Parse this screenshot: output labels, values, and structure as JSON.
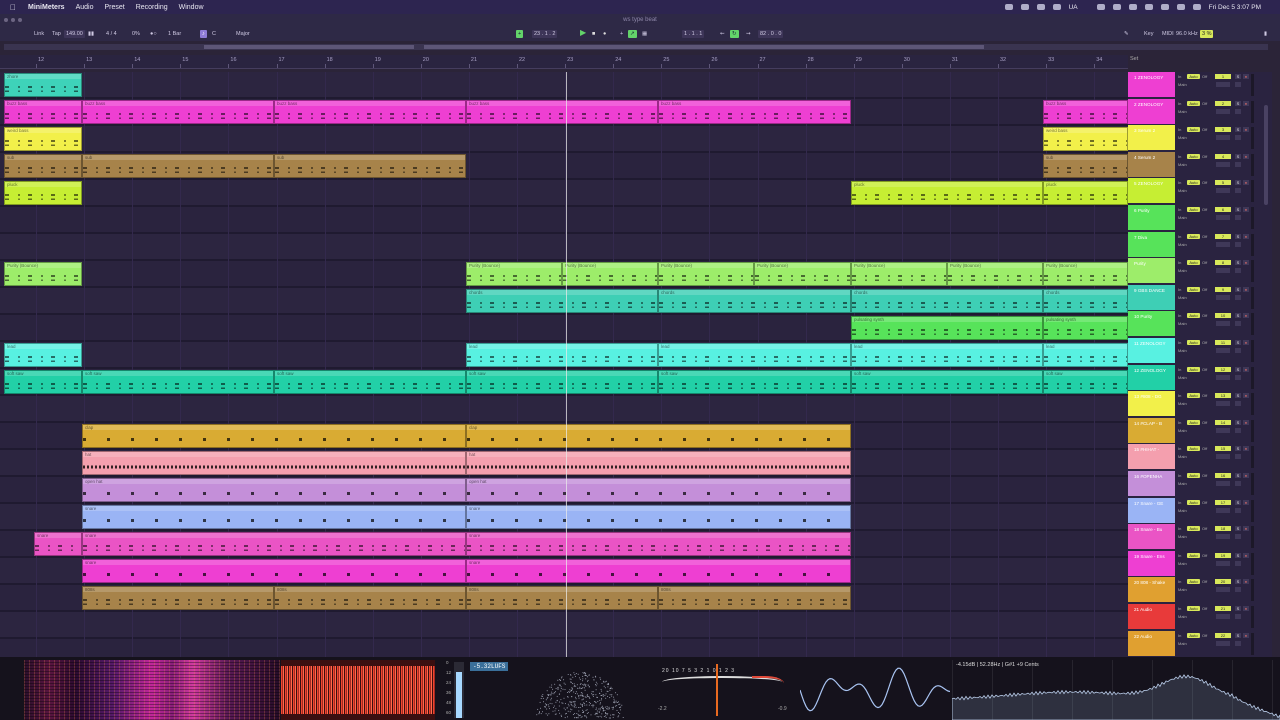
{
  "menubar": {
    "app": "MiniMeters",
    "items": [
      "Audio",
      "Preset",
      "Recording",
      "Window"
    ],
    "clock": "Fri Dec 5  3:07 PM",
    "ua": "UA"
  },
  "titlebar": {
    "title": "ws type beat"
  },
  "transport": {
    "link": "Link",
    "tap": "Tap",
    "tempo": "149.00",
    "signature": "4 / 4",
    "groove": "0%",
    "quant": "1 Bar",
    "key": "C",
    "scale": "Major",
    "position": "23 . 1 . 2",
    "loop_start": "1 . 1 . 1",
    "loop_length": "82 . 0 . 0",
    "key_label": "Key",
    "midi_label": "MIDI",
    "cpu_label": "96.0 kHz",
    "cpu_pct": "3 %"
  },
  "ruler": {
    "bars": [
      "12",
      "13",
      "14",
      "15",
      "16",
      "17",
      "18",
      "19",
      "20",
      "21",
      "22",
      "23",
      "24",
      "25",
      "26",
      "27",
      "28",
      "29",
      "30",
      "31",
      "32",
      "33",
      "34"
    ],
    "set_label": "Set"
  },
  "clips": [
    {
      "lane": 0,
      "start": 4,
      "end": 82,
      "color": "#3ed3b9",
      "name": "zhore"
    },
    {
      "lane": 1,
      "start": 4,
      "end": 82,
      "color": "#ee3fd2",
      "name": "buzz bass"
    },
    {
      "lane": 1,
      "start": 82,
      "end": 274,
      "color": "#ee3fd2",
      "name": "buzz bass"
    },
    {
      "lane": 1,
      "start": 274,
      "end": 466,
      "color": "#ee3fd2",
      "name": "buzz bass"
    },
    {
      "lane": 1,
      "start": 466,
      "end": 658,
      "color": "#ee3fd2",
      "name": "buzz bass"
    },
    {
      "lane": 1,
      "start": 658,
      "end": 851,
      "color": "#ee3fd2",
      "name": "buzz bass"
    },
    {
      "lane": 1,
      "start": 1043,
      "end": 1128,
      "color": "#ee3fd2",
      "name": "buzz bass"
    },
    {
      "lane": 2,
      "start": 4,
      "end": 82,
      "color": "#f2f04a",
      "name": "weird bass"
    },
    {
      "lane": 2,
      "start": 1043,
      "end": 1128,
      "color": "#f2f04a",
      "name": "weird bass"
    },
    {
      "lane": 3,
      "start": 4,
      "end": 82,
      "color": "#a7834a",
      "name": "sub"
    },
    {
      "lane": 3,
      "start": 82,
      "end": 274,
      "color": "#a7834a",
      "name": "sub"
    },
    {
      "lane": 3,
      "start": 274,
      "end": 466,
      "color": "#a7834a",
      "name": "sub"
    },
    {
      "lane": 3,
      "start": 1043,
      "end": 1128,
      "color": "#a7834a",
      "name": "sub"
    },
    {
      "lane": 4,
      "start": 4,
      "end": 82,
      "color": "#c6ee33",
      "name": "pluck"
    },
    {
      "lane": 4,
      "start": 851,
      "end": 1043,
      "color": "#c6ee33",
      "name": "pluck"
    },
    {
      "lane": 4,
      "start": 1043,
      "end": 1128,
      "color": "#c6ee33",
      "name": "pluck"
    },
    {
      "lane": 7,
      "start": 4,
      "end": 82,
      "color": "#9ded6a",
      "name": "Purity (Bounce)"
    },
    {
      "lane": 7,
      "start": 466,
      "end": 562,
      "color": "#9ded6a",
      "name": "Purity (Bounce)"
    },
    {
      "lane": 7,
      "start": 562,
      "end": 658,
      "color": "#9ded6a",
      "name": "Purity (Bounce)"
    },
    {
      "lane": 7,
      "start": 658,
      "end": 754,
      "color": "#9ded6a",
      "name": "Purity (Bounce)"
    },
    {
      "lane": 7,
      "start": 754,
      "end": 851,
      "color": "#9ded6a",
      "name": "Purity (Bounce)"
    },
    {
      "lane": 7,
      "start": 851,
      "end": 947,
      "color": "#9ded6a",
      "name": "Purity (Bounce)"
    },
    {
      "lane": 7,
      "start": 947,
      "end": 1043,
      "color": "#9ded6a",
      "name": "Purity (Bounce)"
    },
    {
      "lane": 7,
      "start": 1043,
      "end": 1128,
      "color": "#9ded6a",
      "name": "Purity (Bounce)"
    },
    {
      "lane": 8,
      "start": 466,
      "end": 658,
      "color": "#3ecfb5",
      "name": "chords"
    },
    {
      "lane": 8,
      "start": 658,
      "end": 851,
      "color": "#3ecfb5",
      "name": "chords"
    },
    {
      "lane": 8,
      "start": 851,
      "end": 1043,
      "color": "#3ecfb5",
      "name": "chords"
    },
    {
      "lane": 8,
      "start": 1043,
      "end": 1128,
      "color": "#3ecfb5",
      "name": "chords"
    },
    {
      "lane": 9,
      "start": 851,
      "end": 1043,
      "color": "#57e35a",
      "name": "pulsating synth"
    },
    {
      "lane": 9,
      "start": 1043,
      "end": 1128,
      "color": "#57e35a",
      "name": "pulsating synth"
    },
    {
      "lane": 10,
      "start": 4,
      "end": 82,
      "color": "#58f1e1",
      "name": "lead"
    },
    {
      "lane": 10,
      "start": 466,
      "end": 658,
      "color": "#58f1e1",
      "name": "lead"
    },
    {
      "lane": 10,
      "start": 658,
      "end": 851,
      "color": "#58f1e1",
      "name": "lead"
    },
    {
      "lane": 10,
      "start": 851,
      "end": 1043,
      "color": "#58f1e1",
      "name": "lead"
    },
    {
      "lane": 10,
      "start": 1043,
      "end": 1128,
      "color": "#58f1e1",
      "name": "lead"
    },
    {
      "lane": 11,
      "start": 4,
      "end": 82,
      "color": "#22d0a7",
      "name": "soft saw"
    },
    {
      "lane": 11,
      "start": 82,
      "end": 274,
      "color": "#22d0a7",
      "name": "soft saw"
    },
    {
      "lane": 11,
      "start": 274,
      "end": 466,
      "color": "#22d0a7",
      "name": "soft saw"
    },
    {
      "lane": 11,
      "start": 466,
      "end": 658,
      "color": "#22d0a7",
      "name": "soft saw"
    },
    {
      "lane": 11,
      "start": 658,
      "end": 851,
      "color": "#22d0a7",
      "name": "soft saw"
    },
    {
      "lane": 11,
      "start": 851,
      "end": 1043,
      "color": "#22d0a7",
      "name": "soft saw"
    },
    {
      "lane": 11,
      "start": 1043,
      "end": 1128,
      "color": "#22d0a7",
      "name": "soft saw"
    },
    {
      "lane": 13,
      "start": 82,
      "end": 466,
      "color": "#d9ab33",
      "name": "clap",
      "kind": "dots"
    },
    {
      "lane": 13,
      "start": 466,
      "end": 851,
      "color": "#d9ab33",
      "name": "clap",
      "kind": "dots"
    },
    {
      "lane": 14,
      "start": 82,
      "end": 466,
      "color": "#f49fae",
      "name": "hat",
      "kind": "dense"
    },
    {
      "lane": 14,
      "start": 466,
      "end": 851,
      "color": "#f49fae",
      "name": "hat",
      "kind": "dense"
    },
    {
      "lane": 15,
      "start": 82,
      "end": 466,
      "color": "#c48fd9",
      "name": "open hat",
      "kind": "dots"
    },
    {
      "lane": 15,
      "start": 466,
      "end": 851,
      "color": "#c48fd9",
      "name": "open hat",
      "kind": "dots"
    },
    {
      "lane": 16,
      "start": 82,
      "end": 466,
      "color": "#9ab4f5",
      "name": "snare",
      "kind": "dots"
    },
    {
      "lane": 16,
      "start": 466,
      "end": 851,
      "color": "#9ab4f5",
      "name": "snare",
      "kind": "dots"
    },
    {
      "lane": 17,
      "start": 34,
      "end": 82,
      "color": "#ea54c5",
      "name": "snare"
    },
    {
      "lane": 17,
      "start": 82,
      "end": 466,
      "color": "#ea54c5",
      "name": "snare"
    },
    {
      "lane": 17,
      "start": 466,
      "end": 851,
      "color": "#ea54c5",
      "name": "snare"
    },
    {
      "lane": 18,
      "start": 82,
      "end": 466,
      "color": "#ee3fd2",
      "name": "snare",
      "kind": "dots"
    },
    {
      "lane": 18,
      "start": 466,
      "end": 851,
      "color": "#ee3fd2",
      "name": "snare",
      "kind": "dots"
    },
    {
      "lane": 19,
      "start": 82,
      "end": 274,
      "color": "#a7834a",
      "name": "808s"
    },
    {
      "lane": 19,
      "start": 274,
      "end": 466,
      "color": "#a7834a",
      "name": "808s"
    },
    {
      "lane": 19,
      "start": 466,
      "end": 658,
      "color": "#a7834a",
      "name": "808s"
    },
    {
      "lane": 19,
      "start": 658,
      "end": 851,
      "color": "#a7834a",
      "name": "808s"
    }
  ],
  "tracks": [
    {
      "name": "1 ZENOLOGY",
      "color": "#ee3fd2",
      "num": "1"
    },
    {
      "name": "2 ZENOLOGY",
      "color": "#ee3fd2",
      "num": "2"
    },
    {
      "name": "3 Serum 2",
      "color": "#f2f04a",
      "num": "3"
    },
    {
      "name": "4 Serum 2",
      "color": "#a7834a",
      "num": "4"
    },
    {
      "name": "5 ZENOLOGY",
      "color": "#c6ee33",
      "num": "5"
    },
    {
      "name": "6 Purity",
      "color": "#57e35a",
      "num": "6"
    },
    {
      "name": "7 Diva",
      "color": "#57e35a",
      "num": "7"
    },
    {
      "name": "Purity",
      "color": "#9ded6a",
      "num": "8"
    },
    {
      "name": "9 GBS DANCE",
      "color": "#3ecfb5",
      "num": "9"
    },
    {
      "name": "10 Purity",
      "color": "#57e35a",
      "num": "10"
    },
    {
      "name": "11 ZENOLOGY",
      "color": "#58f1e1",
      "num": "11"
    },
    {
      "name": "12 ZENOLOGY",
      "color": "#22d0a7",
      "num": "12"
    },
    {
      "name": "13 #808 - DG",
      "color": "#f2f04a",
      "num": "13"
    },
    {
      "name": "14 #CLAP - B",
      "color": "#d9ab33",
      "num": "14"
    },
    {
      "name": "15 #HIHAT -",
      "color": "#f49fae",
      "num": "15"
    },
    {
      "name": "16 #OPENHA",
      "color": "#c48fd9",
      "num": "16"
    },
    {
      "name": "17 Snare - GE",
      "color": "#9ab4f5",
      "num": "17"
    },
    {
      "name": "18 Snare - Bu",
      "color": "#ea54c5",
      "num": "18"
    },
    {
      "name": "19 Snare - Ens",
      "color": "#ee3fd2",
      "num": "19"
    },
    {
      "name": "20 808 - Shake",
      "color": "#e0a030",
      "num": "20"
    },
    {
      "name": "21 Audio",
      "color": "#e83a3a",
      "num": "21"
    },
    {
      "name": "22 Audio",
      "color": "#e0a030",
      "num": "22"
    }
  ],
  "track_labels": {
    "in": "In",
    "auto": "Auto",
    "off": "Off",
    "main": "Main",
    "solo": "S",
    "rec": "●"
  },
  "meters": {
    "lufs_value": "-5.32LUFS",
    "lufs_scale": [
      "0",
      "12",
      "24",
      "36",
      "48",
      "60"
    ],
    "vu_scale": "20 10 7 5 3 2 1 0 1 2 3",
    "vu_left": "-2.2",
    "vu_right": "-0.9",
    "spectrum_readout": "-4.15dB | 52.28Hz | G#1 +9 Cents"
  }
}
